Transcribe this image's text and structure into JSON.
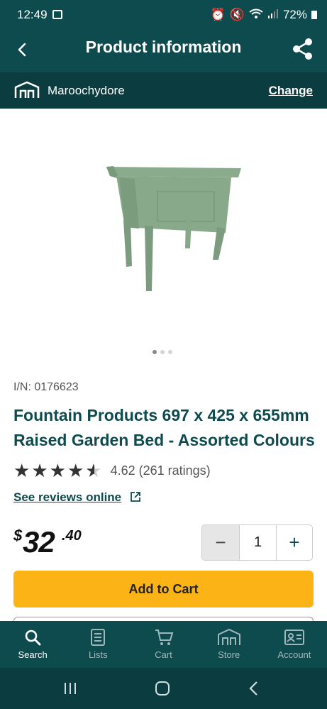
{
  "status_bar": {
    "time": "12:49",
    "battery": "72%"
  },
  "header": {
    "title": "Product information"
  },
  "store": {
    "name": "Maroochydore",
    "change_label": "Change"
  },
  "product": {
    "item_number": "I/N: 0176623",
    "title": "Fountain Products 697 x 425 x 655mm Raised Garden Bed - Assorted Colours",
    "rating_value": 4.62,
    "rating_text": "4.62 (261 ratings)",
    "reviews_link": "See reviews online",
    "price": {
      "currency": "$",
      "dollars": "32",
      "cents": ".40"
    },
    "image_count": 3,
    "image_active": 1,
    "color": "#8aab8c"
  },
  "cart": {
    "quantity": "1",
    "add_label": "Add to Cart"
  },
  "bottom_nav": [
    {
      "label": "Search",
      "icon": "search-icon",
      "active": true
    },
    {
      "label": "Lists",
      "icon": "list-icon",
      "active": false
    },
    {
      "label": "Cart",
      "icon": "cart-icon",
      "active": false
    },
    {
      "label": "Store",
      "icon": "store-icon",
      "active": false
    },
    {
      "label": "Account",
      "icon": "account-icon",
      "active": false
    }
  ],
  "colors": {
    "header": "#0e4b4f",
    "store_bar": "#0b3d40",
    "accent": "#fbb316"
  }
}
